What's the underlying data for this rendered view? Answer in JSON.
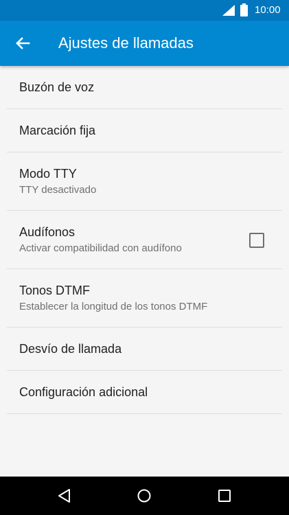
{
  "status_bar": {
    "time": "10:00",
    "icons": [
      "signal-icon",
      "battery-icon"
    ]
  },
  "app_bar": {
    "back_icon": "arrow-back-icon",
    "title": "Ajustes de llamadas",
    "color": "#0288d1"
  },
  "settings": {
    "voicemail": {
      "label": "Buzón de voz"
    },
    "fixed_dialing": {
      "label": "Marcación fija"
    },
    "tty_mode": {
      "label": "Modo TTY",
      "summary": "TTY desactivado"
    },
    "hearing_aids": {
      "label": "Audífonos",
      "summary": "Activar compatibilidad con audífono",
      "checked": false
    },
    "dtmf_tones": {
      "label": "Tonos DTMF",
      "summary": "Establecer la longitud de los tonos DTMF"
    },
    "call_forwarding": {
      "label": "Desvío de llamada"
    },
    "additional_settings": {
      "label": "Configuración adicional"
    }
  },
  "nav_bar": {
    "buttons": [
      "nav-back-icon",
      "nav-home-icon",
      "nav-recents-icon"
    ]
  }
}
